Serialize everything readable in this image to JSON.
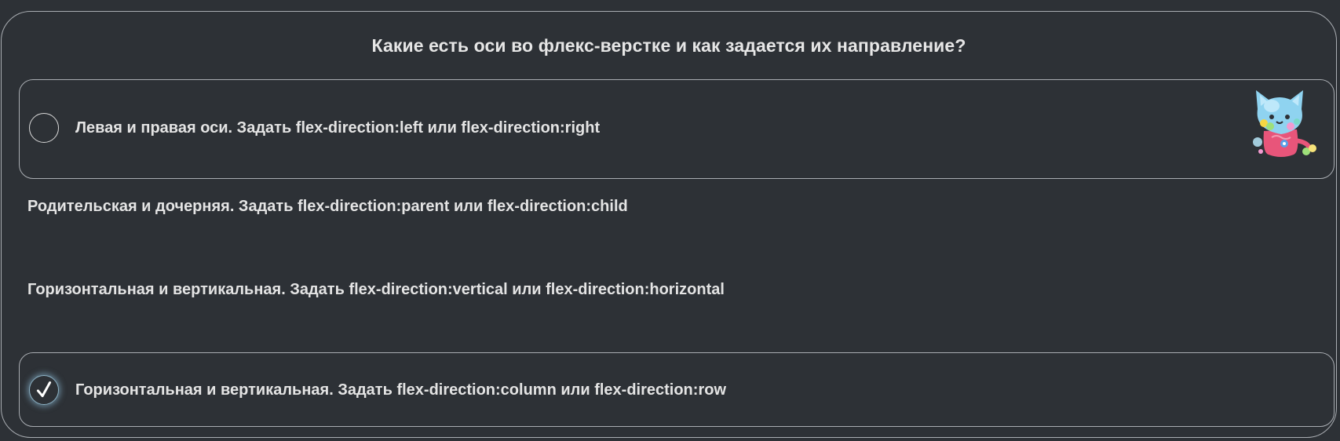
{
  "quiz": {
    "question": "Какие есть оси во флекс-верстке и как задается их направление?",
    "options": [
      {
        "label": "Левая и правая оси. Задать flex-direction:left или flex-direction:right",
        "selected": false
      },
      {
        "label": "Родительская и дочерняя. Задать flex-direction:parent или flex-direction:child",
        "selected": false
      },
      {
        "label": "Горизонтальная и вертикальная. Задать flex-direction:vertical или flex-direction:horizontal",
        "selected": false
      },
      {
        "label": "Горизонтальная и вертикальная. Задать flex-direction:column или flex-direction:row",
        "selected": true
      }
    ]
  },
  "icons": {
    "mascot": "cat-mascot-icon",
    "check": "check-icon"
  },
  "colors": {
    "background": "#2d3136",
    "border": "#a9adb2",
    "text": "#e4e4e4",
    "selected_glow": "#96c8e6"
  }
}
